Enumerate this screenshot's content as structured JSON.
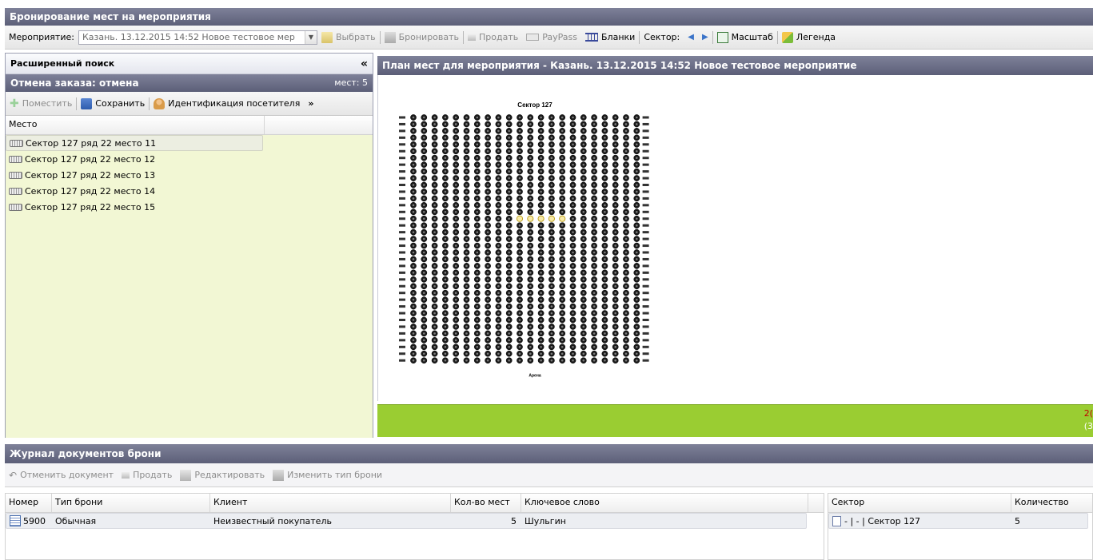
{
  "window": {
    "title": "Бронирование мест на мероприятия"
  },
  "toolbar": {
    "event_label": "Мероприятие:",
    "event_value": "Казань. 13.12.2015 14:52 Новое тестовое мер",
    "select_label": "Выбрать",
    "book_label": "Бронировать",
    "sell_label": "Продать",
    "paypass_label": "PayPass",
    "blanks_label": "Бланки",
    "sector_label": "Сектор:",
    "scale_label": "Масштаб",
    "legend_label": "Легенда"
  },
  "left_panel": {
    "search_title": "Расширенный поиск",
    "collapse_glyph": "«",
    "order_title": "Отмена заказа: отмена",
    "seats_count": "мест: 5",
    "actions": {
      "place_label": "Поместить",
      "save_label": "Сохранить",
      "identify_label": "Идентификация посетителя",
      "more_glyph": "»"
    },
    "column_header": "Место",
    "seats": [
      "Сектор 127 ряд 22 место 11",
      "Сектор 127 ряд 22 место 12",
      "Сектор 127 ряд 22 место 13",
      "Сектор 127 ряд 22 место 14",
      "Сектор 127 ряд 22 место 15"
    ]
  },
  "plan": {
    "title": "План мест для мероприятия - Казань. 13.12.2015 14:52 Новое тестовое мероприятие",
    "sector_caption": "Сектор 127",
    "stage_caption": "Арена",
    "rows": 37,
    "seats_per_row": 22,
    "highlighted_row": 22,
    "highlighted_seats": [
      11,
      12,
      13,
      14,
      15
    ],
    "status_bar_color": "#9acd32",
    "status_text_1": "2(",
    "status_text_2": "(3"
  },
  "journal": {
    "title": "Журнал документов брони",
    "actions": {
      "cancel_label": "Отменить документ",
      "sell_label": "Продать",
      "edit_label": "Редактировать",
      "change_type_label": "Изменить тип брони"
    },
    "columns": {
      "number": "Номер",
      "type": "Тип брони",
      "client": "Клиент",
      "seats": "Кол-во мест",
      "keyword": "Ключевое слово"
    },
    "rows": [
      {
        "number": "5900",
        "type": "Обычная",
        "client": "Неизвестный покупатель",
        "seats": "5",
        "keyword": "Шульгин"
      }
    ]
  },
  "sectors_table": {
    "columns": {
      "sector": "Сектор",
      "quantity": "Количество"
    },
    "rows": [
      {
        "sector": "- | - | Сектор 127",
        "quantity": "5"
      }
    ]
  }
}
